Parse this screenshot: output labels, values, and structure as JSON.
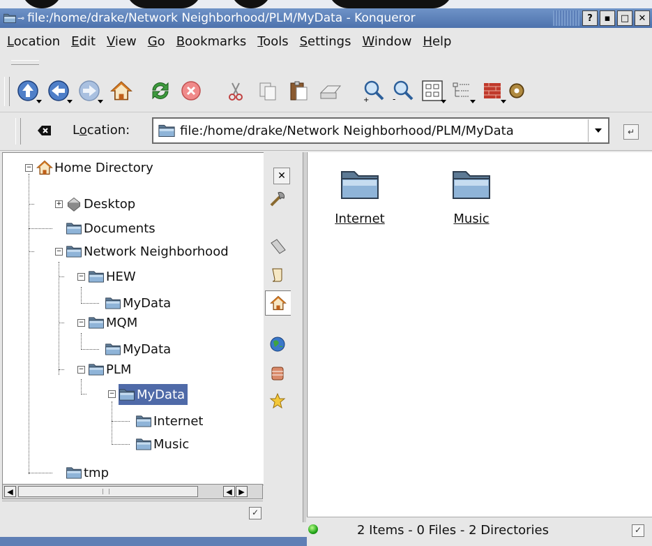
{
  "window": {
    "title": "file:/home/drake/Network Neighborhood/PLM/MyData - Konqueror",
    "controls": [
      "?",
      "▪",
      "□",
      "✕"
    ]
  },
  "menu": [
    {
      "label": "Location",
      "key": "L",
      "rest": "ocation"
    },
    {
      "label": "Edit",
      "key": "E",
      "rest": "dit"
    },
    {
      "label": "View",
      "key": "V",
      "rest": "iew"
    },
    {
      "label": "Go",
      "key": "G",
      "rest": "o"
    },
    {
      "label": "Bookmarks",
      "key": "B",
      "rest": "ookmarks"
    },
    {
      "label": "Tools",
      "key": "T",
      "rest": "ools"
    },
    {
      "label": "Settings",
      "key": "S",
      "rest": "ettings"
    },
    {
      "label": "Window",
      "key": "W",
      "rest": "indow"
    },
    {
      "label": "Help",
      "key": "H",
      "rest": "elp"
    }
  ],
  "toolbar": {
    "icons": [
      "up-arrow-icon",
      "back-arrow-icon",
      "forward-arrow-icon",
      "home-icon",
      "reload-icon",
      "stop-icon",
      "cut-icon",
      "copy-icon",
      "paste-icon",
      "print-icon",
      "zoom-in-icon",
      "zoom-out-icon",
      "icon-view-icon",
      "tree-view-icon",
      "firewall-icon",
      "settings-gear-icon"
    ]
  },
  "location": {
    "label_pre": "L",
    "label_key": "o",
    "label_post": "cation:",
    "url": "file:/home/drake/Network Neighborhood/PLM/MyData"
  },
  "tree": [
    {
      "label": "Home Directory",
      "icon": "home-icon"
    },
    {
      "label": "Desktop",
      "icon": "desktop-icon"
    },
    {
      "label": "Documents",
      "icon": "folder-icon"
    },
    {
      "label": "Network Neighborhood",
      "icon": "folder-icon"
    },
    {
      "label": "HEW",
      "icon": "folder-icon"
    },
    {
      "label": "MyData",
      "icon": "folder-icon"
    },
    {
      "label": "MQM",
      "icon": "folder-open-icon"
    },
    {
      "label": "MyData",
      "icon": "folder-icon"
    },
    {
      "label": "PLM",
      "icon": "folder-icon"
    },
    {
      "label": "MyData",
      "icon": "folder-open-icon",
      "selected": true
    },
    {
      "label": "Internet",
      "icon": "folder-icon"
    },
    {
      "label": "Music",
      "icon": "folder-icon"
    },
    {
      "label": "tmp",
      "icon": "folder-icon"
    }
  ],
  "sidebar_buttons": [
    "tools-icon",
    "bookmarks-icon",
    "history-icon",
    "home-icon",
    "network-icon",
    "services-icon",
    "favorites-star-icon"
  ],
  "files": [
    {
      "label": "Internet",
      "icon": "folder-icon"
    },
    {
      "label": "Music",
      "icon": "folder-icon"
    }
  ],
  "status": {
    "text": "2 Items - 0 Files - 2 Directories"
  },
  "colors": {
    "titlebar": "#5b80bb",
    "selection": "#4f6aa8",
    "chrome": "#e7e7e7"
  }
}
